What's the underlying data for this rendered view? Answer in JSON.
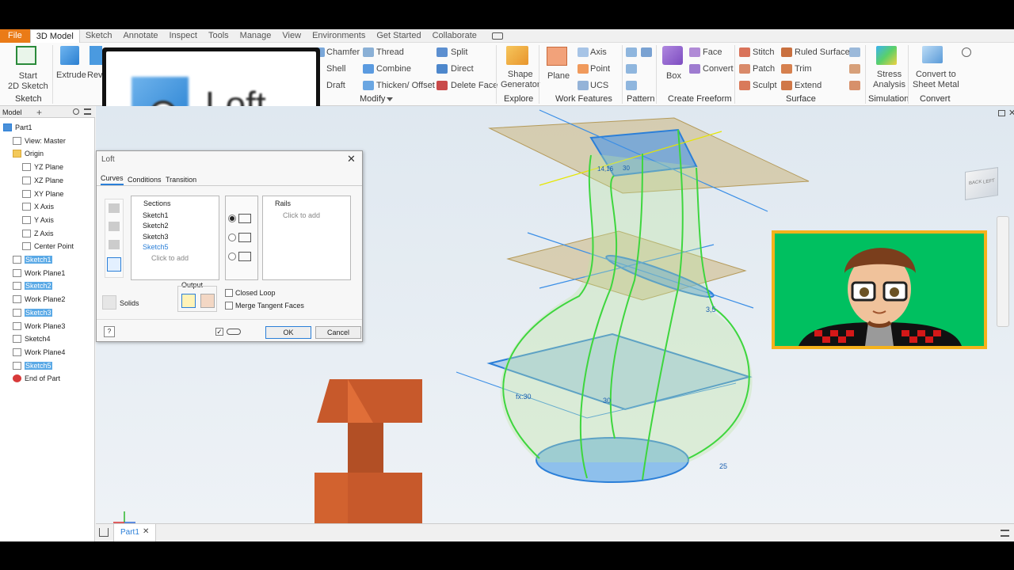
{
  "menu": {
    "tabs": [
      "File",
      "3D Model",
      "Sketch",
      "Annotate",
      "Inspect",
      "Tools",
      "Manage",
      "View",
      "Environments",
      "Get Started",
      "Collaborate"
    ],
    "active": "3D Model"
  },
  "ribbon": {
    "start_sketch": "Start\n2D Sketch",
    "extrude": "Extrude",
    "revolve": "Rev",
    "sketch_group": "Sketch",
    "chamfer": "Chamfer",
    "shell": "Shell",
    "draft": "Draft",
    "thread": "Thread",
    "combine": "Combine",
    "thicken": "Thicken/ Offset",
    "split": "Split",
    "direct": "Direct",
    "delete_face": "Delete Face",
    "modify_group": "Modify",
    "shape_generator": "Shape\nGenerator",
    "explore_group": "Explore",
    "plane": "Plane",
    "axis": "Axis",
    "point": "Point",
    "ucs": "UCS",
    "work_features_group": "Work Features",
    "pattern_group": "Pattern",
    "box": "Box",
    "face": "Face",
    "convert": "Convert",
    "create_freeform_group": "Create Freeform",
    "stitch": "Stitch",
    "patch": "Patch",
    "sculpt": "Sculpt",
    "ruled_surface": "Ruled Surface",
    "trim": "Trim",
    "extend": "Extend",
    "surface_group": "Surface",
    "stress_analysis": "Stress\nAnalysis",
    "simulation_group": "Simulation",
    "convert_sheet": "Convert to\nSheet Metal",
    "convert_group": "Convert"
  },
  "browser": {
    "tab": "Model",
    "items": [
      {
        "label": "Part1",
        "indent": 0,
        "highlight": false
      },
      {
        "label": "View: Master",
        "indent": 1,
        "highlight": false
      },
      {
        "label": "Origin",
        "indent": 1,
        "highlight": false
      },
      {
        "label": "YZ Plane",
        "indent": 2,
        "highlight": false
      },
      {
        "label": "XZ Plane",
        "indent": 2,
        "highlight": false
      },
      {
        "label": "XY Plane",
        "indent": 2,
        "highlight": false
      },
      {
        "label": "X Axis",
        "indent": 2,
        "highlight": false
      },
      {
        "label": "Y Axis",
        "indent": 2,
        "highlight": false
      },
      {
        "label": "Z Axis",
        "indent": 2,
        "highlight": false
      },
      {
        "label": "Center Point",
        "indent": 2,
        "highlight": false
      },
      {
        "label": "Sketch1",
        "indent": 1,
        "highlight": true
      },
      {
        "label": "Work Plane1",
        "indent": 1,
        "highlight": false
      },
      {
        "label": "Sketch2",
        "indent": 1,
        "highlight": true
      },
      {
        "label": "Work Plane2",
        "indent": 1,
        "highlight": false
      },
      {
        "label": "Sketch3",
        "indent": 1,
        "highlight": true
      },
      {
        "label": "Work Plane3",
        "indent": 1,
        "highlight": false
      },
      {
        "label": "Sketch4",
        "indent": 1,
        "highlight": false
      },
      {
        "label": "Work Plane4",
        "indent": 1,
        "highlight": false
      },
      {
        "label": "Sketch5",
        "indent": 1,
        "highlight": true
      },
      {
        "label": "End of Part",
        "indent": 1,
        "highlight": false
      }
    ]
  },
  "loft_popup": {
    "label": "Loft"
  },
  "dialog": {
    "title": "Loft",
    "tabs": [
      "Curves",
      "Conditions",
      "Transition"
    ],
    "sections_header": "Sections",
    "sections": [
      "Sketch1",
      "Sketch2",
      "Sketch3",
      "Sketch5"
    ],
    "click_to_add": "Click to add",
    "rails_header": "Rails",
    "output_label": "Output",
    "solids_label": "Solids",
    "closed_loop": "Closed Loop",
    "merge_tangent": "Merge Tangent Faces",
    "ok": "OK",
    "cancel": "Cancel"
  },
  "viewport": {
    "dims": [
      "3,5",
      "fx:30",
      "30",
      "25",
      "14,16",
      "30"
    ],
    "viewcube": [
      "BACK",
      "LEFT"
    ]
  },
  "docbar": {
    "tab": "Part1"
  }
}
